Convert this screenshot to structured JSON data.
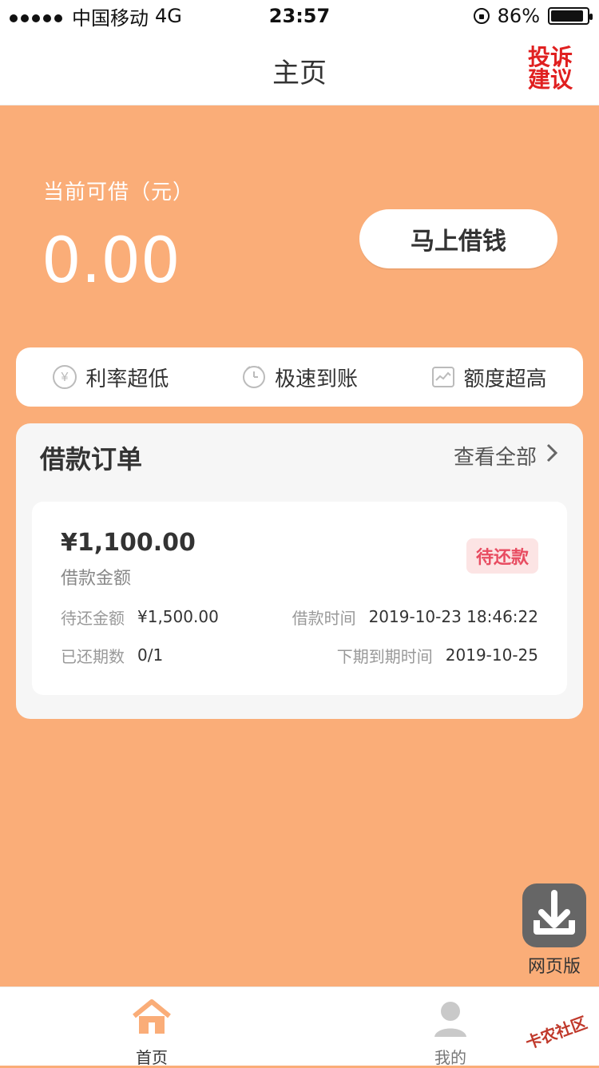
{
  "status_bar": {
    "carrier": "中国移动",
    "network": "4G",
    "time": "23:57",
    "battery_percent": "86%"
  },
  "header": {
    "title": "主页",
    "complaint_label": "投诉建议"
  },
  "hero": {
    "available_label": "当前可借（元）",
    "available_amount": "0.00",
    "borrow_button": "马上借钱"
  },
  "features": [
    {
      "label": "利率超低",
      "icon": "yen-icon"
    },
    {
      "label": "极速到账",
      "icon": "clock-icon"
    },
    {
      "label": "额度超高",
      "icon": "chart-icon"
    }
  ],
  "orders": {
    "title": "借款订单",
    "view_all": "查看全部",
    "card": {
      "amount": "¥1,100.00",
      "amount_label": "借款金额",
      "status": "待还款",
      "due_amount_label": "待还金额",
      "due_amount": "¥1,500.00",
      "loan_time_label": "借款时间",
      "loan_time": "2019-10-23 18:46:22",
      "paid_periods_label": "已还期数",
      "paid_periods": "0/1",
      "next_due_label": "下期到期时间",
      "next_due": "2019-10-25"
    }
  },
  "floating": {
    "web_version": "网页版"
  },
  "tabbar": {
    "home": "首页",
    "me": "我的"
  },
  "watermark": "卡农社区",
  "colors": {
    "accent": "#FAAD78",
    "badge_bg": "#FCE4E4",
    "badge_text": "#E84C61",
    "complaint_red": "#E02020"
  }
}
